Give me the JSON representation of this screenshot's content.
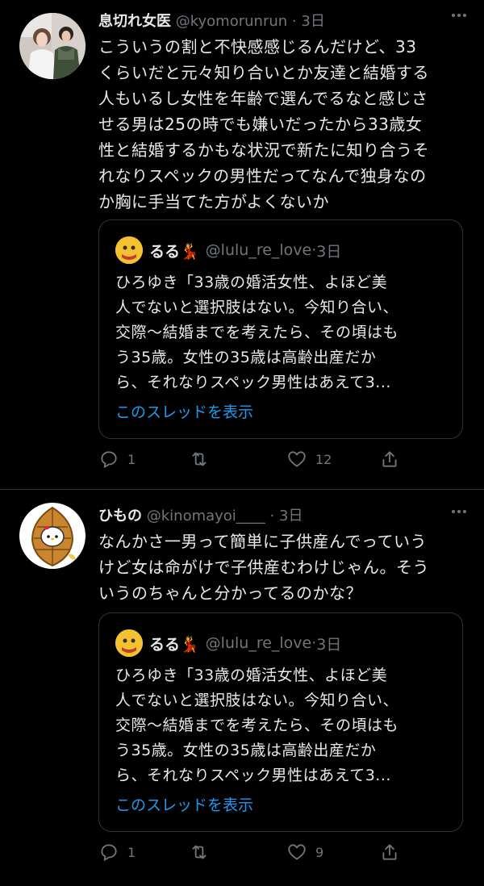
{
  "tweets": [
    {
      "name": "息切れ女医",
      "handle": "@kyomorunrun",
      "dot": "·",
      "time": "3日",
      "lines": [
        "こういうの割と不快感感じるんだけど、33",
        "くらいだと元々知り合いとか友達と結婚する",
        "人もいるし女性を年齢で選んでるなと感じさ",
        "せる男は25の時でも嫌いだったから33歳女",
        "性と結婚するかもな状況で新たに知り合うそ",
        "れなりスペックの男性だってなんで独身なの",
        "か胸に手当てた方がよくないか"
      ],
      "quote": {
        "name": "るる💃",
        "handle": "@lulu_re_love",
        "dot": "·",
        "time": "3日",
        "lines": [
          "ひろゆき「33歳の婚活女性、よほど美",
          "人でないと選択肢はない。今知り合い、",
          "交際〜結婚までを考えたら、その頃はも",
          "う35歳。女性の35歳は高齢出産だか",
          "ら、それなりスペック男性はあえて3..."
        ],
        "show_thread": "このスレッドを表示"
      },
      "replies": "1",
      "retweets": "",
      "likes": "12"
    },
    {
      "name": "ひもの",
      "handle": "@kinomayoi____",
      "dot": "·",
      "time": "3日",
      "lines": [
        "なんかさ一男って簡単に子供産んでっていう",
        "けど女は命がけで子供産むわけじゃん。そう",
        "いうのちゃんと分かってるのかな？"
      ],
      "quote": {
        "name": "るる💃",
        "handle": "@lulu_re_love",
        "dot": "·",
        "time": "3日",
        "lines": [
          "ひろゆき「33歳の婚活女性、よほど美",
          "人でないと選択肢はない。今知り合い、",
          "交際〜結婚までを考えたら、その頃はも",
          "う35歳。女性の35歳は高齢出産だか",
          "ら、それなりスペック男性はあえて3..."
        ],
        "show_thread": "このスレッドを表示"
      },
      "replies": "1",
      "retweets": "",
      "likes": "9"
    }
  ],
  "more_icon": "more-dots-icon",
  "colors": {
    "background": "#000000",
    "text": "#e7e9ea",
    "muted": "#71767b",
    "link": "#1d9bf0",
    "border": "#2f3336"
  }
}
